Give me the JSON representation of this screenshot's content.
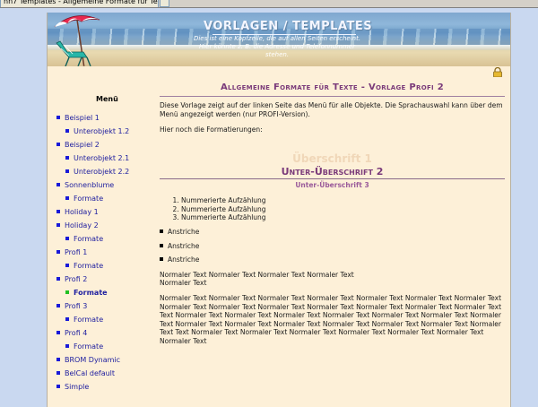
{
  "browser": {
    "tab_title": "nn7 Templates - Allgemeine Formate für Texte - ..."
  },
  "header": {
    "title": "VORLAGEN / TEMPLATES",
    "subtitle": "Dies ist eine Kopfzeile, die auf allen Seiten erscheint. Hier könnte z. B. die Adresse und Telefonnummer stehen."
  },
  "icons": {
    "banner_illustration": "beach-chair-umbrella-illustration",
    "lock": "lock-icon"
  },
  "menu": {
    "title": "Menü",
    "items": [
      {
        "label": "Beispiel 1",
        "level": 1
      },
      {
        "label": "Unterobjekt 1.2",
        "level": 2
      },
      {
        "label": "Beispiel 2",
        "level": 1
      },
      {
        "label": "Unterobjekt 2.1",
        "level": 2
      },
      {
        "label": "Unterobjekt 2.2",
        "level": 2
      },
      {
        "label": "Sonnenblume",
        "level": 1
      },
      {
        "label": "Formate",
        "level": 2
      },
      {
        "label": "Holiday 1",
        "level": 1
      },
      {
        "label": "Holiday 2",
        "level": 1
      },
      {
        "label": "Formate",
        "level": 2
      },
      {
        "label": "Profi 1",
        "level": 1
      },
      {
        "label": "Formate",
        "level": 2
      },
      {
        "label": "Profi 2",
        "level": 1
      },
      {
        "label": "Formate",
        "level": 2,
        "active": true
      },
      {
        "label": "Profi 3",
        "level": 1
      },
      {
        "label": "Formate",
        "level": 2
      },
      {
        "label": "Profi 4",
        "level": 1
      },
      {
        "label": "Formate",
        "level": 2
      },
      {
        "label": "BROM Dynamic",
        "level": 1
      },
      {
        "label": "BelCal default",
        "level": 1
      },
      {
        "label": "Simple",
        "level": 1
      }
    ]
  },
  "content": {
    "title": "Allgemeine Formate für Texte - Vorlage Profi 2",
    "intro": "Diese Vorlage zeigt auf der linken Seite das Menü für alle Objekte. Die Sprachauswahl kann über dem Menü angezeigt werden (nur PROFI-Version).",
    "formatting_label": "Hier noch die Formatierungen:",
    "heading1": "Überschrift 1",
    "heading2": "Unter-Überschrift 2",
    "heading3": "Unter-Überschrift 3",
    "numbered_list": [
      "Nummerierte Aufzählung",
      "Nummerierte Aufzählung",
      "Nummerierte Aufzählung"
    ],
    "bullet_list": [
      "Anstriche",
      "Anstriche",
      "Anstriche"
    ],
    "normal_text_1": "Normaler Text Normaler Text Normaler Text Normaler Text",
    "normal_text_2": "Normaler Text",
    "normal_text_block": "Normaler Text Normaler Text Normaler Text Normaler Text Normaler Text Normaler Text Normaler Text Normaler Text Normaler Text Normaler Text Normaler Text Normaler Text Normaler Text Normaler Text Text Normaler Text Normaler Text Normaler Text Normaler Text Normaler Text Normaler Text Normaler Text Normaler Text Normaler Text Normaler Text Normaler Text Normaler Text Normaler Text Normaler Text Text Normaler Text Normaler Text Normaler Text Normaler Text Normaler Text Normaler Text Normaler Text"
  },
  "colors": {
    "page_bg": "#fdf0d8",
    "outer_bg": "#c9d8f0",
    "heading_purple": "#7a3a7a",
    "menu_link": "#2020a0",
    "bullet_blue": "#1a1ad8",
    "bullet_active": "#22c022"
  }
}
